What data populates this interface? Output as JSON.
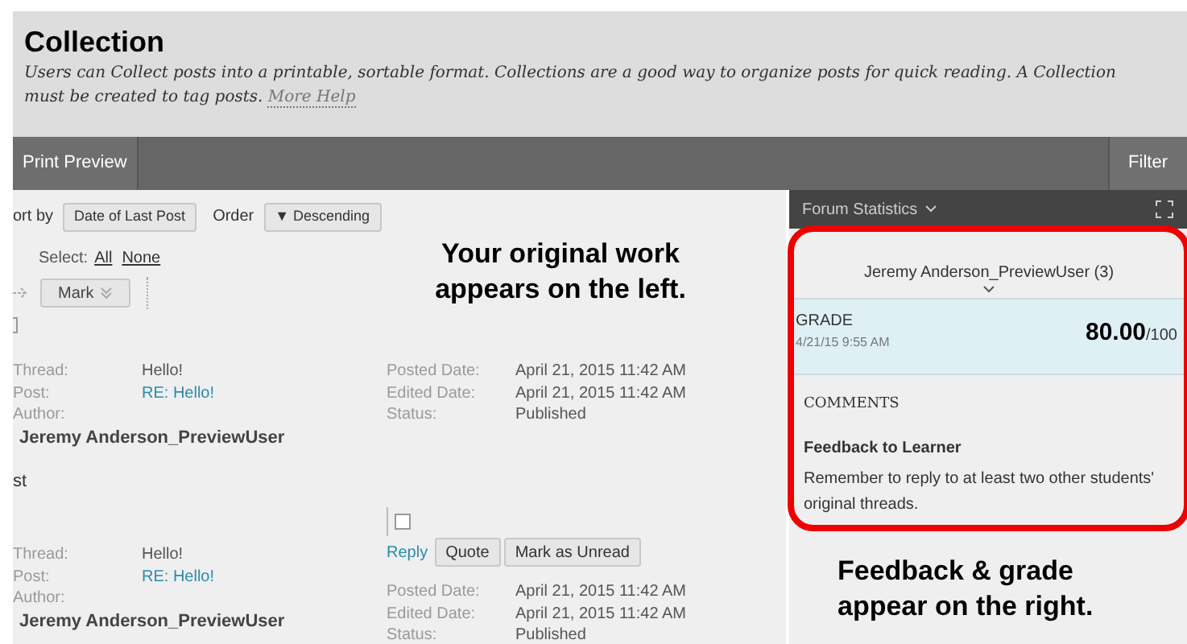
{
  "header": {
    "title": "Collection",
    "description": "Users can Collect posts into a printable, sortable format. Collections are a good way to organize posts for quick reading. A Collection must be created to tag posts.",
    "help_link": "More Help"
  },
  "toolbar": {
    "left": "Print Preview",
    "right": "Filter"
  },
  "sort": {
    "sort_label": "ort by",
    "sort_value": "Date of Last Post",
    "order_label": "Order",
    "order_value": "▼ Descending"
  },
  "select": {
    "label": "Select:",
    "all": "All",
    "none": "None"
  },
  "mark_button": "Mark",
  "annotations": [
    {
      "text": "Your original work appears on the left."
    },
    {
      "text": "Feedback & grade appear on the right."
    }
  ],
  "posts": [
    {
      "thread_label": "Thread:",
      "thread": "Hello!",
      "post_label": "Post:",
      "post": "RE: Hello!",
      "author_label": "Author:",
      "author": "Jeremy Anderson_PreviewUser",
      "posted_label": "Posted Date:",
      "posted": "April 21, 2015 11:42 AM",
      "edited_label": "Edited Date:",
      "edited": "April 21, 2015 11:42 AM",
      "status_label": "Status:",
      "status": "Published",
      "body": "st"
    },
    {
      "thread_label": "Thread:",
      "thread": "Hello!",
      "post_label": "Post:",
      "post": "RE: Hello!",
      "author_label": "Author:",
      "author": "Jeremy Anderson_PreviewUser",
      "posted_label": "Posted Date:",
      "posted": "April 21, 2015 11:42 AM",
      "edited_label": "Edited Date:",
      "edited": "April 21, 2015 11:42 AM",
      "status_label": "Status:",
      "status": "Published",
      "actions": {
        "checked": false,
        "reply": "Reply",
        "buttons": [
          "Quote",
          "Mark as Unread"
        ]
      }
    }
  ],
  "side_panel": {
    "title": "Forum Statistics",
    "user": "Jeremy Anderson_PreviewUser (3)",
    "grade_label": "GRADE",
    "grade_date": "4/21/15 9:55 AM",
    "score": "80.00",
    "out_of": "/100",
    "comments_heading": "COMMENTS",
    "feedback_title": "Feedback to Learner",
    "feedback_text": "Remember to reply to at least two other students' original threads."
  }
}
